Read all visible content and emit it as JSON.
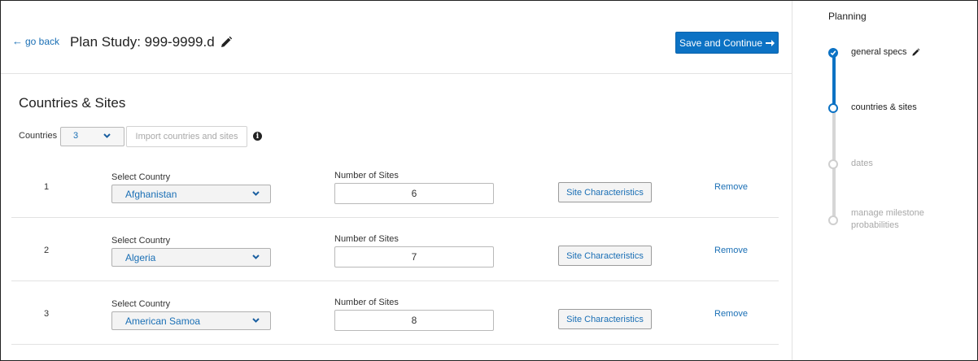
{
  "header": {
    "go_back": "go back",
    "title": "Plan Study: 999-9999.d",
    "save_button": "Save and Continue"
  },
  "section": {
    "title": "Countries & Sites",
    "countries_label": "Countries",
    "countries_value": "3",
    "import_button": "Import countries and sites"
  },
  "labels": {
    "select_country": "Select Country",
    "number_of_sites": "Number of Sites",
    "site_characteristics": "Site Characteristics",
    "remove": "Remove"
  },
  "rows": [
    {
      "index": "1",
      "country": "Afghanistan",
      "sites": "6"
    },
    {
      "index": "2",
      "country": "Algeria",
      "sites": "7"
    },
    {
      "index": "3",
      "country": "American Samoa",
      "sites": "8"
    }
  ],
  "sidebar": {
    "title": "Planning",
    "steps": [
      {
        "label": "general specs",
        "state": "completed"
      },
      {
        "label": "countries & sites",
        "state": "current"
      },
      {
        "label": "dates",
        "state": "upcoming"
      },
      {
        "label": "manage milestone probabilities",
        "state": "upcoming"
      }
    ]
  },
  "colors": {
    "accent": "#0c72c4",
    "link": "#1a6fb5",
    "inactive": "#cfcfcf",
    "inactive_text": "#a8a8a8"
  }
}
